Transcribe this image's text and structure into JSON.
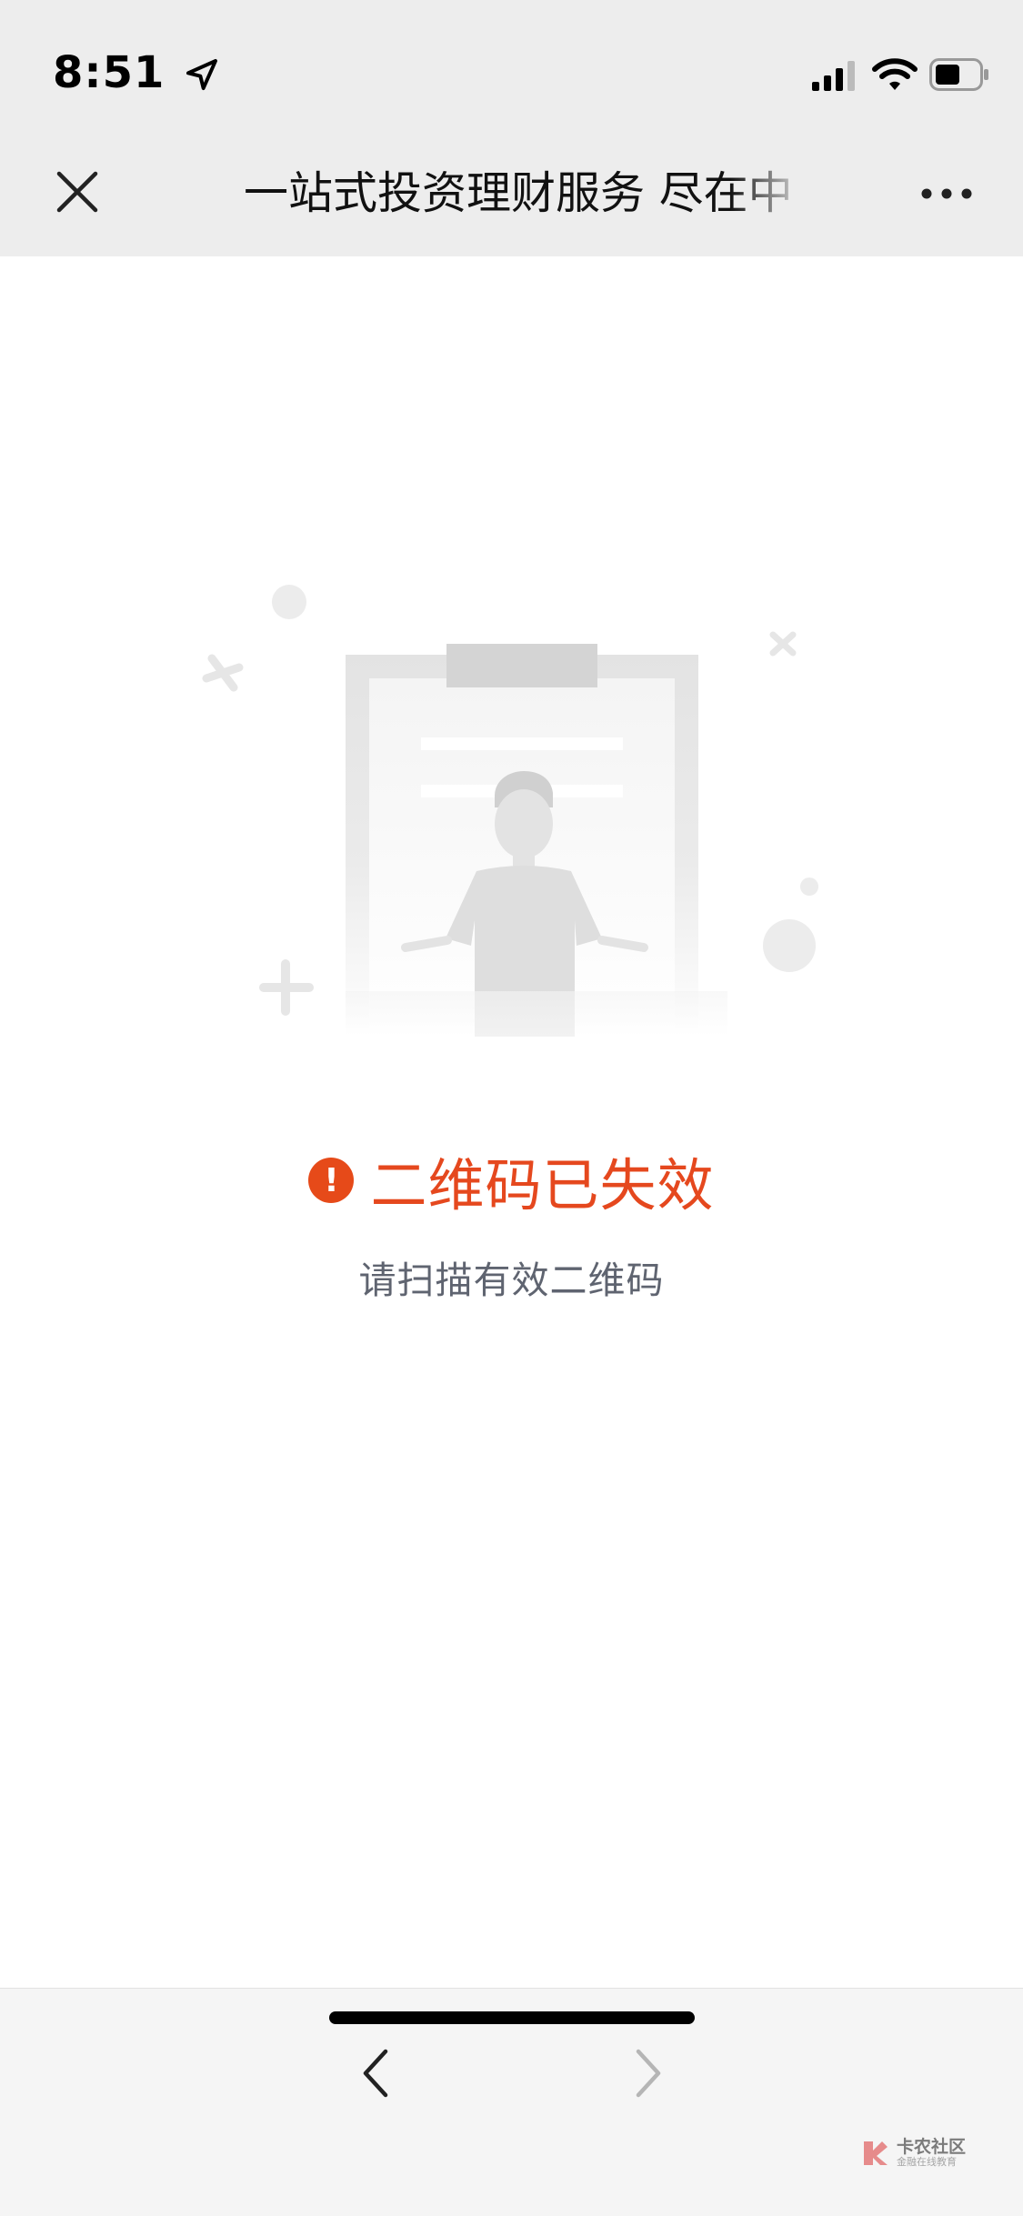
{
  "status_bar": {
    "time": "8:51",
    "icons": [
      "location-arrow-icon",
      "signal-icon",
      "wifi-icon",
      "battery-icon"
    ]
  },
  "nav": {
    "title": "一站式投资理财服务 尽在中",
    "close_icon": "close-icon",
    "more_icon": "more-icon"
  },
  "content": {
    "illustration": "clipboard-person-shrug",
    "error_title": "二维码已失效",
    "error_icon_glyph": "!",
    "hint": "请扫描有效二维码"
  },
  "bottom_nav": {
    "back_icon": "chevron-left-icon",
    "forward_icon": "chevron-right-icon",
    "forward_enabled": false
  },
  "watermark": {
    "main": "卡农社区",
    "sub": "金融在线教育"
  },
  "colors": {
    "bar_bg": "#ededed",
    "error": "#e5481e",
    "hint": "#5f6470",
    "bottom_bg": "#f5f5f5"
  }
}
